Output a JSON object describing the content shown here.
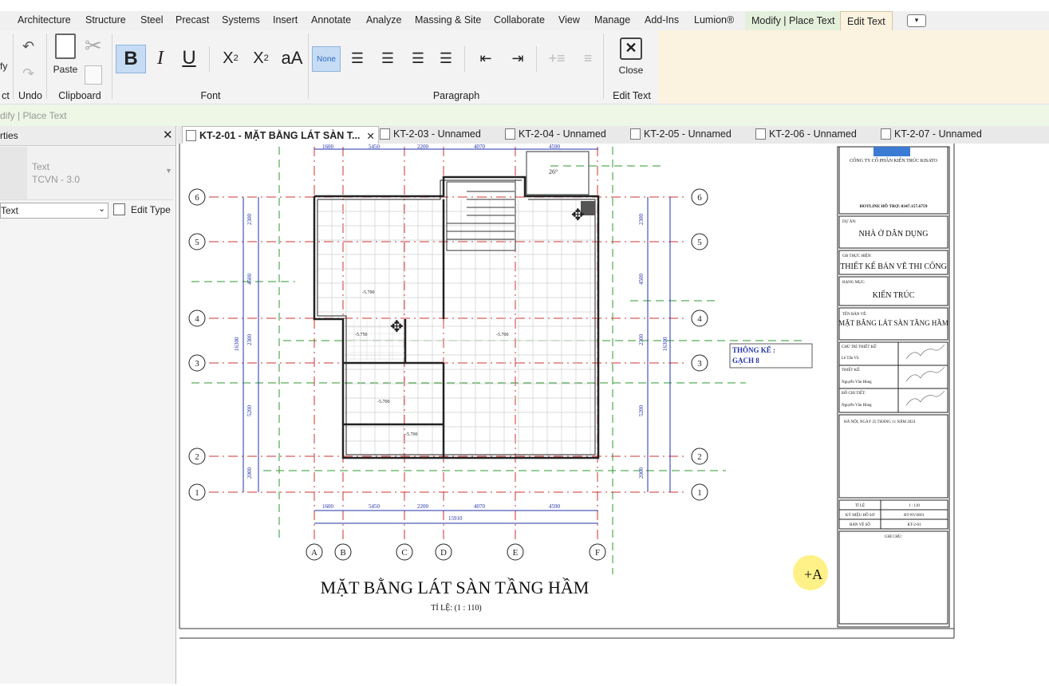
{
  "ribbon_tabs": [
    "Architecture",
    "Structure",
    "Steel",
    "Precast",
    "Systems",
    "Insert",
    "Annotate",
    "Analyze",
    "Massing & Site",
    "Collaborate",
    "View",
    "Manage",
    "Add-Ins",
    "Lumion®",
    "Modify | Place Text",
    "Edit Text"
  ],
  "ribbon": {
    "paste": "Paste",
    "none": "None",
    "close": "Close",
    "panels": {
      "modify": "ct",
      "undo": "Undo",
      "clipboard": "Clipboard",
      "font": "Font",
      "paragraph": "Paragraph",
      "edit_text": "Edit Text"
    },
    "modify_partial": "fy"
  },
  "option_bar": "dify | Place Text",
  "properties": {
    "title": "rties",
    "type_family": "Text",
    "type_name": "TCVN - 3.0",
    "selector": "Text",
    "edit_type": "Edit Type"
  },
  "view_tabs": [
    "KT-2-01 - MẶT BẰNG LÁT SÀN T...",
    "KT-2-03 - Unnamed",
    "KT-2-04 - Unnamed",
    "KT-2-05 - Unnamed",
    "KT-2-06 - Unnamed",
    "KT-2-07 - Unnamed"
  ],
  "drawing": {
    "title": "MẶT BẰNG LÁT SÀN TẦNG HẦM",
    "scale": "TỈ LỆ: (1 : 110)",
    "grid_rows": [
      "6",
      "5",
      "4",
      "3",
      "2",
      "1"
    ],
    "grid_cols": [
      "A",
      "B",
      "C",
      "D",
      "E",
      "F"
    ],
    "dims_top": [
      "1600",
      "5450",
      "2200",
      "4070",
      "4590"
    ],
    "dims_bottom": [
      "1600",
      "5450",
      "2200",
      "4070",
      "4590"
    ],
    "dim_total": "15910",
    "dims_left": [
      "2300",
      "4500",
      "2300",
      "5200",
      "2000"
    ],
    "dim_left_total": "16300",
    "levels": [
      "-5.700",
      "-5.750",
      "-5.700",
      "-5.700",
      "-5.700"
    ],
    "note_label": "THÔNG KẾ :",
    "note_value": "GẠCH 8",
    "stair_slope": "26°"
  },
  "title_block": {
    "company": "CÔNG TY CỔ PHẦN KIẾN TRÚC KISATO",
    "hotline": "HOTLINE HỖ TRỢ: 0347.157.6759",
    "project_label": "DỰ ÁN:",
    "project": "NHÀ Ở DÂN DỤNG",
    "phase_label": "GĐ THỰC HIỆN:",
    "phase": "THIẾT KẾ BẢN VẼ THI CÔNG",
    "category_label": "HẠNG MỤC:",
    "category": "KIẾN TRÚC",
    "sheet_label": "TÊN BẢN VẼ:",
    "sheet": "MẶT BẰNG LÁT SÀN TẦNG HẦM",
    "roles": [
      "CHỦ TRÌ THIẾT KẾ:",
      "THIẾT KẾ:",
      "ĐỒ CHI TIẾT:"
    ],
    "names": [
      "Lê Tấn Vũ",
      "Nguyễn Văn Hùng",
      "Nguyễn Văn Hùng"
    ],
    "date": "HÀ NỘI, NGÀY 25 THÁNG 11 NĂM 2024",
    "scale_label": "TỈ LỆ",
    "scale_value": "1 : 110",
    "code_label": "KÝ HIỆU HỒ SƠ",
    "code_value": "BT-NV-HO1",
    "sheetno_label": "BẢN VẼ SỐ",
    "sheetno_value": "KT-2-01",
    "notes_label": "GHI CHÚ:"
  }
}
